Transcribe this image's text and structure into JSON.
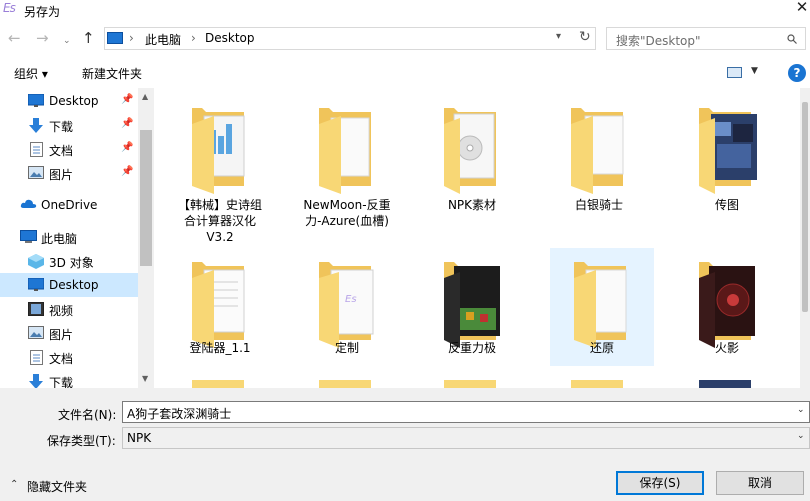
{
  "window": {
    "title": "另存为",
    "app_icon": "Es"
  },
  "nav": {
    "back_icon": "arrow-left-icon",
    "forward_icon": "arrow-right-icon",
    "up_icon": "arrow-up-icon"
  },
  "address": {
    "crumbs": [
      "此电脑",
      "Desktop"
    ]
  },
  "search": {
    "placeholder": "搜索\"Desktop\""
  },
  "toolbar": {
    "organize": "组织 ▾",
    "new_folder": "新建文件夹"
  },
  "sidebar": {
    "items": [
      {
        "label": "Desktop",
        "icon": "desktop-icon",
        "pinned": true
      },
      {
        "label": "下载",
        "icon": "download-icon",
        "pinned": true
      },
      {
        "label": "文档",
        "icon": "document-icon",
        "pinned": true
      },
      {
        "label": "图片",
        "icon": "picture-icon",
        "pinned": true
      },
      {
        "label": "OneDrive",
        "icon": "cloud-icon"
      },
      {
        "label": "此电脑",
        "icon": "computer-icon"
      },
      {
        "label": "3D 对象",
        "icon": "cube-icon"
      },
      {
        "label": "Desktop",
        "icon": "desktop-icon",
        "selected": true
      },
      {
        "label": "视频",
        "icon": "video-icon"
      },
      {
        "label": "图片",
        "icon": "picture-icon"
      },
      {
        "label": "文档",
        "icon": "document-icon"
      },
      {
        "label": "下载",
        "icon": "download-icon"
      }
    ]
  },
  "files": [
    {
      "line1": "【韩械】史诗组",
      "line2": "合计算器汉化",
      "line3": "V3.2"
    },
    {
      "line1": "NewMoon-反重",
      "line2": "力-Azure(血槽)",
      "line3": ""
    },
    {
      "line1": "NPK素材",
      "line2": "",
      "line3": ""
    },
    {
      "line1": "白银骑士",
      "line2": "",
      "line3": ""
    },
    {
      "line1": "传图",
      "line2": "",
      "line3": ""
    },
    {
      "line1": "登陆器_1.1",
      "line2": "",
      "line3": ""
    },
    {
      "line1": "定制",
      "line2": "",
      "line3": ""
    },
    {
      "line1": "反重力极",
      "line2": "",
      "line3": ""
    },
    {
      "line1": "还原",
      "line2": "",
      "line3": ""
    },
    {
      "line1": "火影",
      "line2": "",
      "line3": ""
    }
  ],
  "form": {
    "filename_label": "文件名(N):",
    "filename_value": "A狗子套改深渊骑士",
    "filetype_label": "保存类型(T):",
    "filetype_value": "NPK",
    "hide_folders": "隐藏文件夹",
    "save_button": "保存(S)",
    "cancel_button": "取消"
  },
  "colors": {
    "accent": "#0078d7",
    "folder": "#f8d775",
    "selection": "#cce8ff"
  }
}
